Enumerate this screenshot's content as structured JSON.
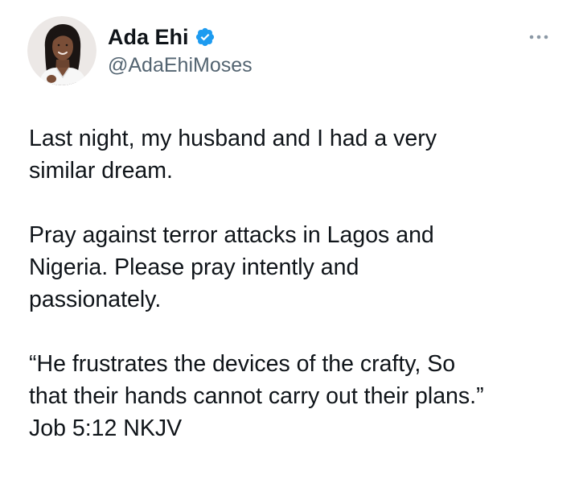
{
  "tweet": {
    "author": {
      "display_name": "Ada Ehi",
      "handle": "@AdaEhiMoses",
      "verified": true,
      "avatar_icon": "profile-photo"
    },
    "more_icon": "more-horizontal-icon",
    "paragraphs": [
      "Last night, my husband and I had a very\nsimilar dream.",
      "Pray against terror attacks in Lagos and\nNigeria. Please pray intently and\npassionately.",
      "“He frustrates the devices of the crafty, So\nthat their hands cannot carry out their plans.”\nJob 5:12 NKJV"
    ]
  },
  "colors": {
    "text": "#0f1419",
    "secondary": "#536471",
    "verified_badge": "#1d9bf0",
    "more_dots": "#8b98a5"
  }
}
